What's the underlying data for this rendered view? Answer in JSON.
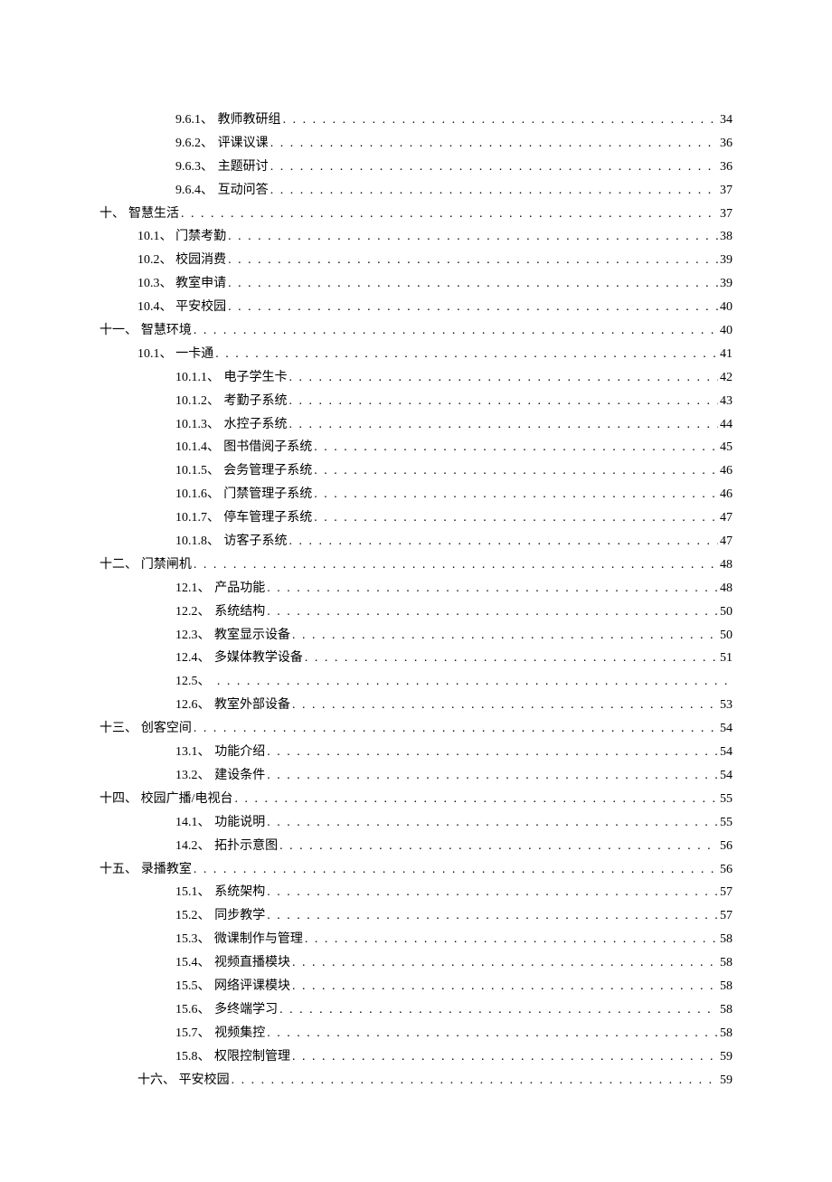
{
  "toc": [
    {
      "indent": 2,
      "num": "9.6.1、",
      "title": "教师教研组",
      "page": "34"
    },
    {
      "indent": 2,
      "num": "9.6.2、",
      "title": "评课议课",
      "page": "36"
    },
    {
      "indent": 2,
      "num": "9.6.3、",
      "title": "主题研讨",
      "page": "36"
    },
    {
      "indent": 2,
      "num": "9.6.4、",
      "title": "互动问答",
      "page": "37"
    },
    {
      "indent": 0,
      "num": "十、",
      "title": "智慧生活",
      "page": "37"
    },
    {
      "indent": 1,
      "num": "10.1、",
      "title": "门禁考勤",
      "page": "38"
    },
    {
      "indent": 1,
      "num": "10.2、",
      "title": "校园消费",
      "page": "39"
    },
    {
      "indent": 1,
      "num": "10.3、",
      "title": "教室申请",
      "page": "39"
    },
    {
      "indent": 1,
      "num": "10.4、",
      "title": "平安校园",
      "page": "40"
    },
    {
      "indent": 0,
      "num": "十一、",
      "title": "智慧环境",
      "page": "40"
    },
    {
      "indent": 1,
      "num": "10.1、",
      "title": "一卡通",
      "page": "41"
    },
    {
      "indent": 2,
      "num": "10.1.1、",
      "title": "电子学生卡",
      "page": "42"
    },
    {
      "indent": 2,
      "num": "10.1.2、",
      "title": "考勤子系统",
      "page": "43"
    },
    {
      "indent": 2,
      "num": "10.1.3、",
      "title": "水控子系统",
      "page": "44"
    },
    {
      "indent": 2,
      "num": "10.1.4、",
      "title": "图书借阅子系统",
      "page": "45"
    },
    {
      "indent": 2,
      "num": "10.1.5、",
      "title": "会务管理子系统",
      "page": "46"
    },
    {
      "indent": 2,
      "num": "10.1.6、",
      "title": "门禁管理子系统",
      "page": "46"
    },
    {
      "indent": 2,
      "num": "10.1.7、",
      "title": "停车管理子系统",
      "page": "47"
    },
    {
      "indent": 2,
      "num": "10.1.8、",
      "title": "访客子系统",
      "page": "47"
    },
    {
      "indent": 0,
      "num": "十二、",
      "title": "门禁闸机",
      "page": "48"
    },
    {
      "indent": 2,
      "num": "12.1、",
      "title": "产品功能",
      "page": "48"
    },
    {
      "indent": 2,
      "num": "12.2、",
      "title": "系统结构",
      "page": "50"
    },
    {
      "indent": 2,
      "num": "12.3、",
      "title": "教室显示设备",
      "page": "50"
    },
    {
      "indent": 2,
      "num": "12.4、",
      "title": "多媒体教学设备",
      "page": "51"
    },
    {
      "indent": 2,
      "num": "12.5、",
      "title": "",
      "page": ""
    },
    {
      "indent": 2,
      "num": "12.6、",
      "title": "教室外部设备",
      "page": "53"
    },
    {
      "indent": 0,
      "num": "十三、",
      "title": "创客空间",
      "page": "54"
    },
    {
      "indent": 2,
      "num": "13.1、",
      "title": "功能介绍",
      "page": "54"
    },
    {
      "indent": 2,
      "num": "13.2、",
      "title": "建设条件",
      "page": "54"
    },
    {
      "indent": 0,
      "num": "十四、",
      "title": "校园广播/电视台",
      "page": "55"
    },
    {
      "indent": 2,
      "num": "14.1、",
      "title": "功能说明",
      "page": "55"
    },
    {
      "indent": 2,
      "num": "14.2、",
      "title": "拓扑示意图",
      "page": "56"
    },
    {
      "indent": 0,
      "num": "十五、",
      "title": "录播教室",
      "page": "56"
    },
    {
      "indent": 2,
      "num": "15.1、",
      "title": "系统架构",
      "page": "57"
    },
    {
      "indent": 2,
      "num": "15.2、",
      "title": "同步教学",
      "page": "57"
    },
    {
      "indent": 2,
      "num": "15.3、",
      "title": "微课制作与管理",
      "page": "58"
    },
    {
      "indent": 2,
      "num": "15.4、",
      "title": "视频直播模块",
      "page": "58"
    },
    {
      "indent": 2,
      "num": "15.5、",
      "title": "网络评课模块",
      "page": "58"
    },
    {
      "indent": 2,
      "num": "15.6、",
      "title": "多终端学习",
      "page": "58"
    },
    {
      "indent": 2,
      "num": "15.7、",
      "title": "视频集控",
      "page": "58"
    },
    {
      "indent": 2,
      "num": "15.8、",
      "title": "权限控制管理",
      "page": "59"
    },
    {
      "indent": 1,
      "num": "十六、",
      "title": "平安校园",
      "page": "59"
    }
  ]
}
